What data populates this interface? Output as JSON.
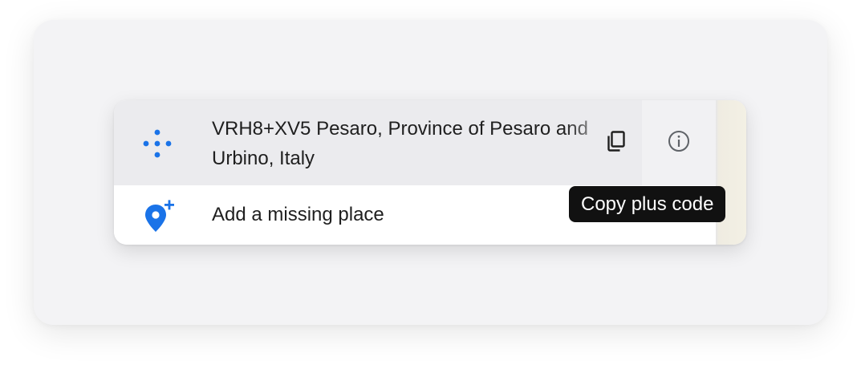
{
  "plus_code_row": {
    "icon": "plus-code-icon",
    "address": "VRH8+XV5 Pesaro, Province of Pesaro and Urbino, Italy",
    "copy_icon": "copy-icon",
    "info_icon": "info-icon"
  },
  "add_place_row": {
    "icon": "add-location-icon",
    "label": "Add a missing place"
  },
  "tooltip": {
    "text": "Copy plus code"
  },
  "colors": {
    "accent": "#1a73e8",
    "text": "#1f1f1f",
    "tooltip_bg": "#111111"
  }
}
